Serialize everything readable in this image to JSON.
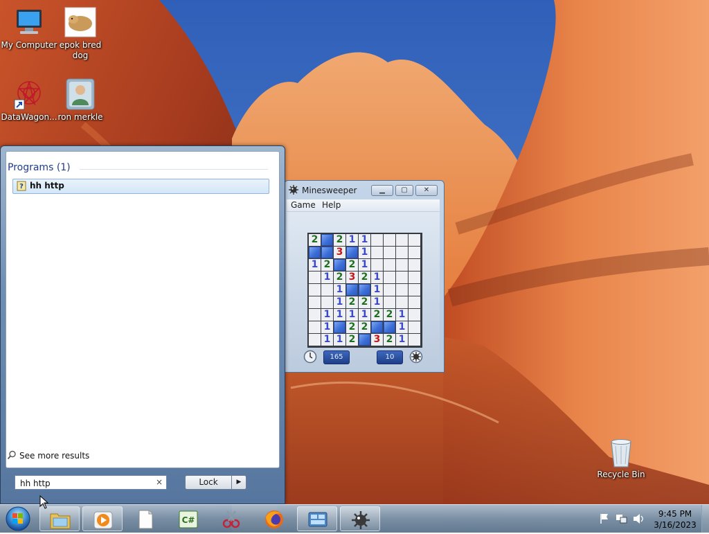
{
  "desktop": {
    "icons": [
      {
        "label": "My Computer",
        "icon": "computer-icon"
      },
      {
        "label": "epok bred dog",
        "icon": "dog-photo-icon"
      },
      {
        "label": "DataWagon...",
        "icon": "datawagon-shortcut-icon"
      },
      {
        "label": "ron merkle",
        "icon": "user-folder-icon"
      },
      {
        "label": "Recycle Bin",
        "icon": "recycle-bin-icon"
      }
    ]
  },
  "start_menu": {
    "programs_heading": "Programs (1)",
    "results": [
      {
        "label": "hh http",
        "icon": "help-file-icon"
      }
    ],
    "see_more": "See more results",
    "search_value": "hh http",
    "clear_glyph": "×",
    "lock_label": "Lock",
    "lock_arrow": "▶"
  },
  "minesweeper": {
    "title": "Minesweeper",
    "menu": [
      "Game",
      "Help"
    ],
    "time": "165",
    "mines": "10",
    "grid": [
      [
        "2",
        "h",
        "2",
        "1",
        "1",
        "u",
        "u",
        "u",
        "u"
      ],
      [
        "h",
        "h",
        "3",
        "h",
        "1",
        "u",
        "u",
        "u",
        "u"
      ],
      [
        "1",
        "2",
        "h",
        "2",
        "1",
        "u",
        "u",
        "u",
        "u"
      ],
      [
        "",
        "1",
        "2",
        "3",
        "2",
        "1",
        "u",
        "u",
        "u"
      ],
      [
        "",
        "",
        "1",
        "h",
        "h",
        "1",
        "u",
        "u",
        "u"
      ],
      [
        "",
        "",
        "1",
        "2",
        "2",
        "1",
        "u",
        "u",
        "u"
      ],
      [
        "",
        "1",
        "1",
        "1",
        "1",
        "2",
        "2",
        "1",
        "u"
      ],
      [
        "",
        "1",
        "h",
        "2",
        "2",
        "h",
        "h",
        "1",
        "u"
      ],
      [
        "",
        "1",
        "1",
        "2",
        "h",
        "3",
        "2",
        "1",
        "u"
      ]
    ]
  },
  "taskbar": {
    "buttons": [
      {
        "name": "explorer-icon",
        "active": true
      },
      {
        "name": "media-player-icon",
        "active": true
      },
      {
        "name": "notepad-icon",
        "active": false
      },
      {
        "name": "csharp-icon",
        "active": false
      },
      {
        "name": "snipping-tool-icon",
        "active": false
      },
      {
        "name": "firefox-icon",
        "active": false
      },
      {
        "name": "control-panel-icon",
        "active": true
      },
      {
        "name": "minesweeper-icon",
        "active": true
      }
    ],
    "time": "9:45 PM",
    "date": "3/16/2023"
  }
}
